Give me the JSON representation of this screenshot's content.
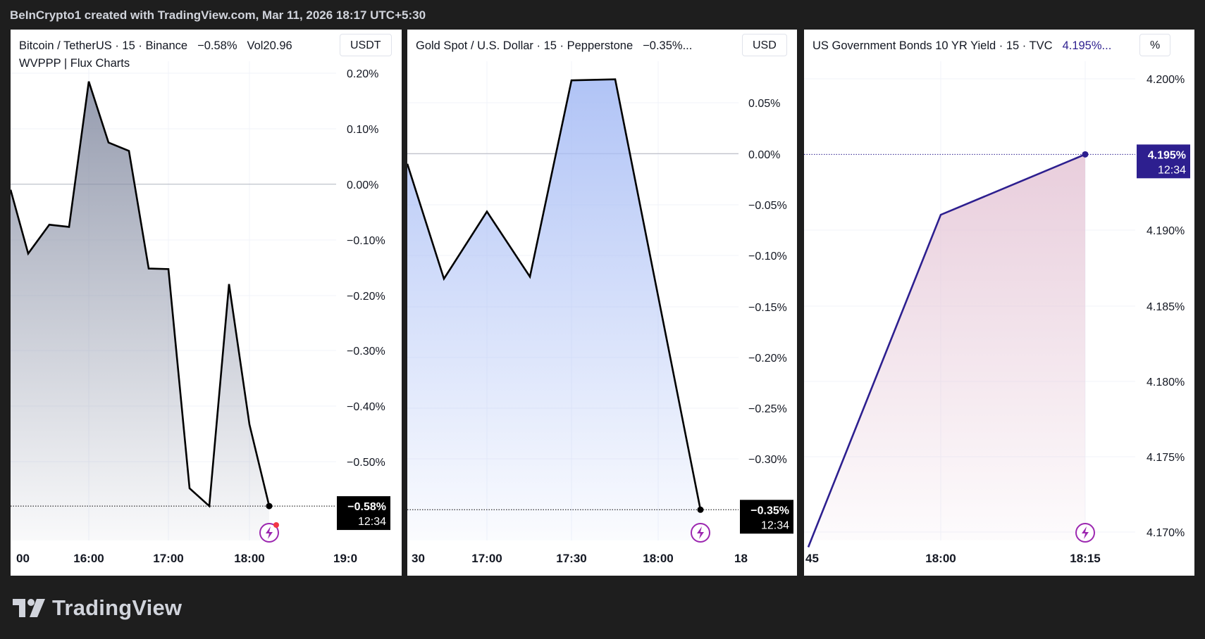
{
  "header": {
    "caption": "BeInCrypto1 created with TradingView.com, Mar 11, 2026 18:17 UTC+5:30"
  },
  "footer": {
    "brand": "TradingView"
  },
  "chart_data": [
    {
      "type": "area",
      "symbol_title": "Bitcoin / TetherUS · 15 · Binance",
      "change": "−0.58%",
      "volume": "Vol20.96",
      "indicator": "WVPPP | Flux Charts",
      "unit": "USDT",
      "line_color": "#000000",
      "fill_color": "#8a91a6",
      "x_ticks": [
        "00",
        "16:00",
        "17:00",
        "18:00",
        "19:0"
      ],
      "y_ticks": [
        "0.20%",
        "0.10%",
        "0.00%",
        "−0.10%",
        "−0.20%",
        "−0.30%",
        "−0.40%",
        "−0.50%"
      ],
      "ylim": [
        -0.66,
        0.22
      ],
      "x": [
        "15:30",
        "15:45",
        "16:00",
        "16:15",
        "16:30",
        "16:45",
        "17:00",
        "17:15",
        "17:30",
        "17:45",
        "18:00",
        "18:15",
        "18:30",
        "18:45",
        "19:00"
      ],
      "values": [
        -0.01,
        -0.125,
        -0.073,
        -0.077,
        0.185,
        0.075,
        0.06,
        -0.152,
        -0.153,
        -0.548,
        -0.58,
        -0.18,
        -0.433,
        -0.58
      ],
      "last_value": "−0.58%",
      "countdown": "12:34",
      "icon": "flash-icon"
    },
    {
      "type": "area",
      "symbol_title": "Gold Spot / U.S. Dollar · 15 · Pepperstone",
      "change": "−0.35%...",
      "unit": "USD",
      "line_color": "#000000",
      "fill_color": "#a8bdf5",
      "x_ticks": [
        "30",
        "17:00",
        "17:30",
        "18:00",
        "18"
      ],
      "y_ticks": [
        "0.05%",
        "0.00%",
        "−0.05%",
        "−0.10%",
        "−0.15%",
        "−0.20%",
        "−0.25%",
        "−0.30%"
      ],
      "ylim": [
        -0.372,
        0.076
      ],
      "x": [
        "16:30",
        "16:45",
        "17:00",
        "17:15",
        "17:30",
        "17:45",
        "18:00",
        "18:15"
      ],
      "values": [
        -0.01,
        -0.123,
        -0.057,
        -0.121,
        0.072,
        0.073,
        -0.35
      ],
      "last_value": "−0.35%",
      "countdown": "12:34",
      "icon": "flash-icon"
    },
    {
      "type": "area",
      "symbol_title": "US Government Bonds 10 YR Yield · 15 · TVC",
      "change": "4.195%...",
      "unit": "%",
      "line_color": "#2d1f8f",
      "fill_color": "#e6c8d8",
      "x_ticks": [
        "45",
        "18:00",
        "18:15"
      ],
      "y_ticks": [
        "4.200%",
        "4.190%",
        "4.185%",
        "4.180%",
        "4.175%",
        "4.170%"
      ],
      "ylim": [
        4.169,
        4.2015
      ],
      "x": [
        "17:45",
        "18:00",
        "18:15"
      ],
      "values": [
        4.169,
        4.191,
        4.195
      ],
      "last_value": "4.195%",
      "countdown": "12:34",
      "icon": "flash-icon"
    }
  ]
}
